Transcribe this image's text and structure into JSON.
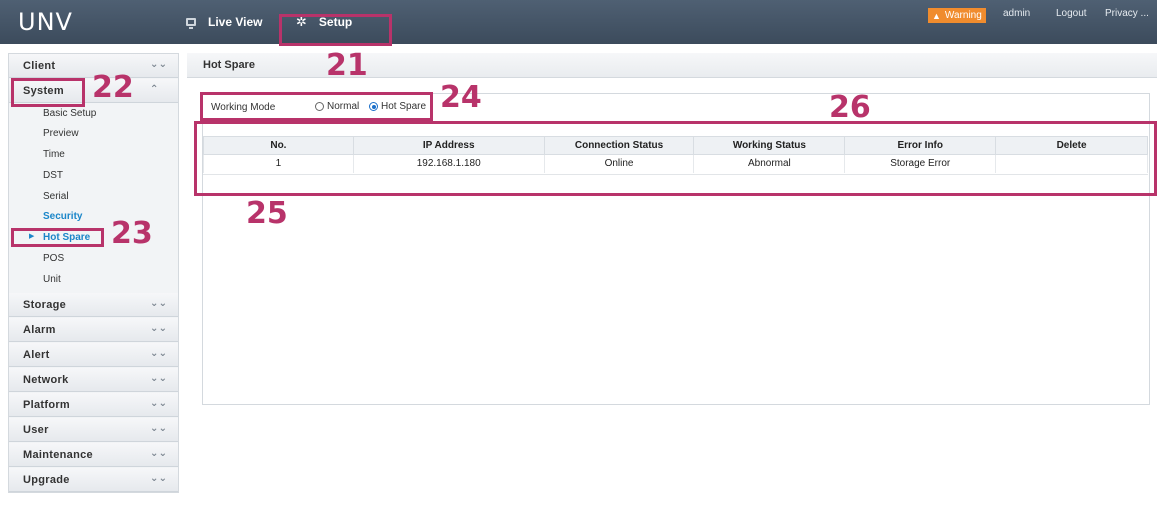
{
  "header": {
    "logo": "UNV",
    "nav": [
      {
        "label": "Live View",
        "icon": "monitor-icon"
      },
      {
        "label": "Setup",
        "icon": "gear-icon"
      }
    ],
    "warning": "Warning",
    "user": "admin",
    "logout": "Logout",
    "privacy": "Privacy ..."
  },
  "sidebar": {
    "sections": [
      {
        "label": "Client",
        "expanded": false
      },
      {
        "label": "System",
        "expanded": true
      },
      {
        "label": "Storage",
        "expanded": false
      },
      {
        "label": "Alarm",
        "expanded": false
      },
      {
        "label": "Alert",
        "expanded": false
      },
      {
        "label": "Network",
        "expanded": false
      },
      {
        "label": "Platform",
        "expanded": false
      },
      {
        "label": "User",
        "expanded": false
      },
      {
        "label": "Maintenance",
        "expanded": false
      },
      {
        "label": "Upgrade",
        "expanded": false
      }
    ],
    "system_items": [
      "Basic Setup",
      "Preview",
      "Time",
      "DST",
      "Serial",
      "Security",
      "Hot Spare",
      "POS",
      "Unit"
    ],
    "selected_item": "Hot Spare"
  },
  "content": {
    "title": "Hot Spare",
    "working_mode": {
      "label": "Working Mode",
      "options": [
        "Normal",
        "Hot Spare"
      ],
      "selected": "Hot Spare"
    },
    "table": {
      "columns": [
        "No.",
        "IP Address",
        "Connection Status",
        "Working Status",
        "Error Info",
        "Delete"
      ],
      "rows": [
        [
          "1",
          "192.168.1.180",
          "Online",
          "Abnormal",
          "Storage Error",
          ""
        ]
      ]
    }
  },
  "annotations": [
    "21",
    "22",
    "23",
    "24",
    "25",
    "26"
  ],
  "colors": {
    "topbar": "#46566a",
    "accent_blue": "#1b86c9",
    "warning_orange": "#f08c2e",
    "annotation": "#b8336a"
  }
}
